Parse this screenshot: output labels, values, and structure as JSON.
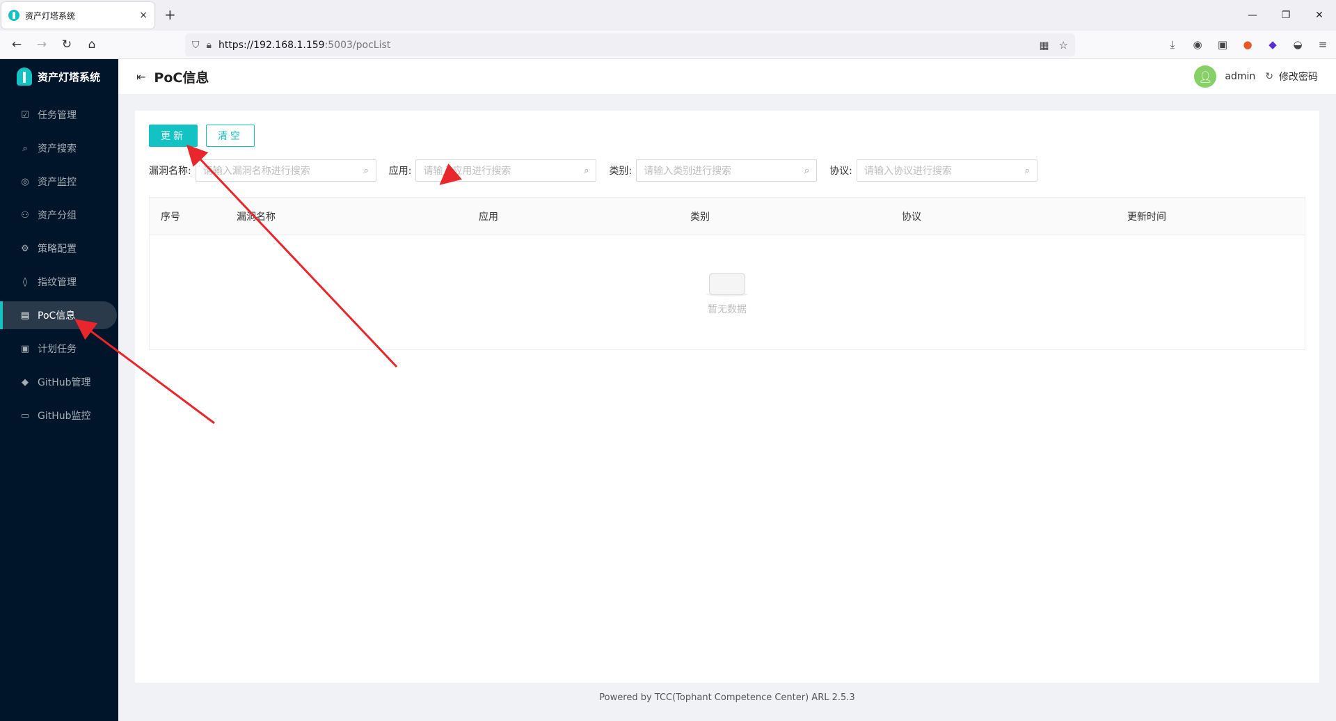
{
  "browser": {
    "tab_title": "资产灯塔系统",
    "tab_close": "×",
    "new_tab": "+",
    "url_host": "https://192.168.1.159",
    "url_rest": ":5003/pocList",
    "win_min": "—",
    "win_max": "❐",
    "win_close": "✕"
  },
  "sidebar": {
    "logo": "资产灯塔系统",
    "items": [
      {
        "label": "任务管理",
        "icon": "☑"
      },
      {
        "label": "资产搜索",
        "icon": "⌕"
      },
      {
        "label": "资产监控",
        "icon": "◎"
      },
      {
        "label": "资产分组",
        "icon": "⚇"
      },
      {
        "label": "策略配置",
        "icon": "⚙"
      },
      {
        "label": "指纹管理",
        "icon": "◊"
      },
      {
        "label": "PoC信息",
        "icon": "▤"
      },
      {
        "label": "计划任务",
        "icon": "▣"
      },
      {
        "label": "GitHub管理",
        "icon": "◆"
      },
      {
        "label": "GitHub监控",
        "icon": "▭"
      }
    ],
    "active_index": 6
  },
  "header": {
    "page_title": "PoC信息",
    "username": "admin",
    "change_password": "修改密码"
  },
  "toolbar": {
    "update_label": "更新",
    "clear_label": "清空"
  },
  "filters": [
    {
      "label": "漏洞名称:",
      "placeholder": "请输入漏洞名称进行搜索"
    },
    {
      "label": "应用:",
      "placeholder": "请输入应用进行搜索"
    },
    {
      "label": "类别:",
      "placeholder": "请输入类别进行搜索"
    },
    {
      "label": "协议:",
      "placeholder": "请输入协议进行搜索"
    }
  ],
  "table": {
    "columns": [
      "序号",
      "漏洞名称",
      "应用",
      "类别",
      "协议",
      "更新时间"
    ],
    "empty_text": "暂无数据"
  },
  "footer": "Powered by TCC(Tophant Competence Center) ARL 2.5.3",
  "colors": {
    "accent": "#13c2c2",
    "sidebar_bg": "#001529",
    "annotation": "#e8262b"
  }
}
